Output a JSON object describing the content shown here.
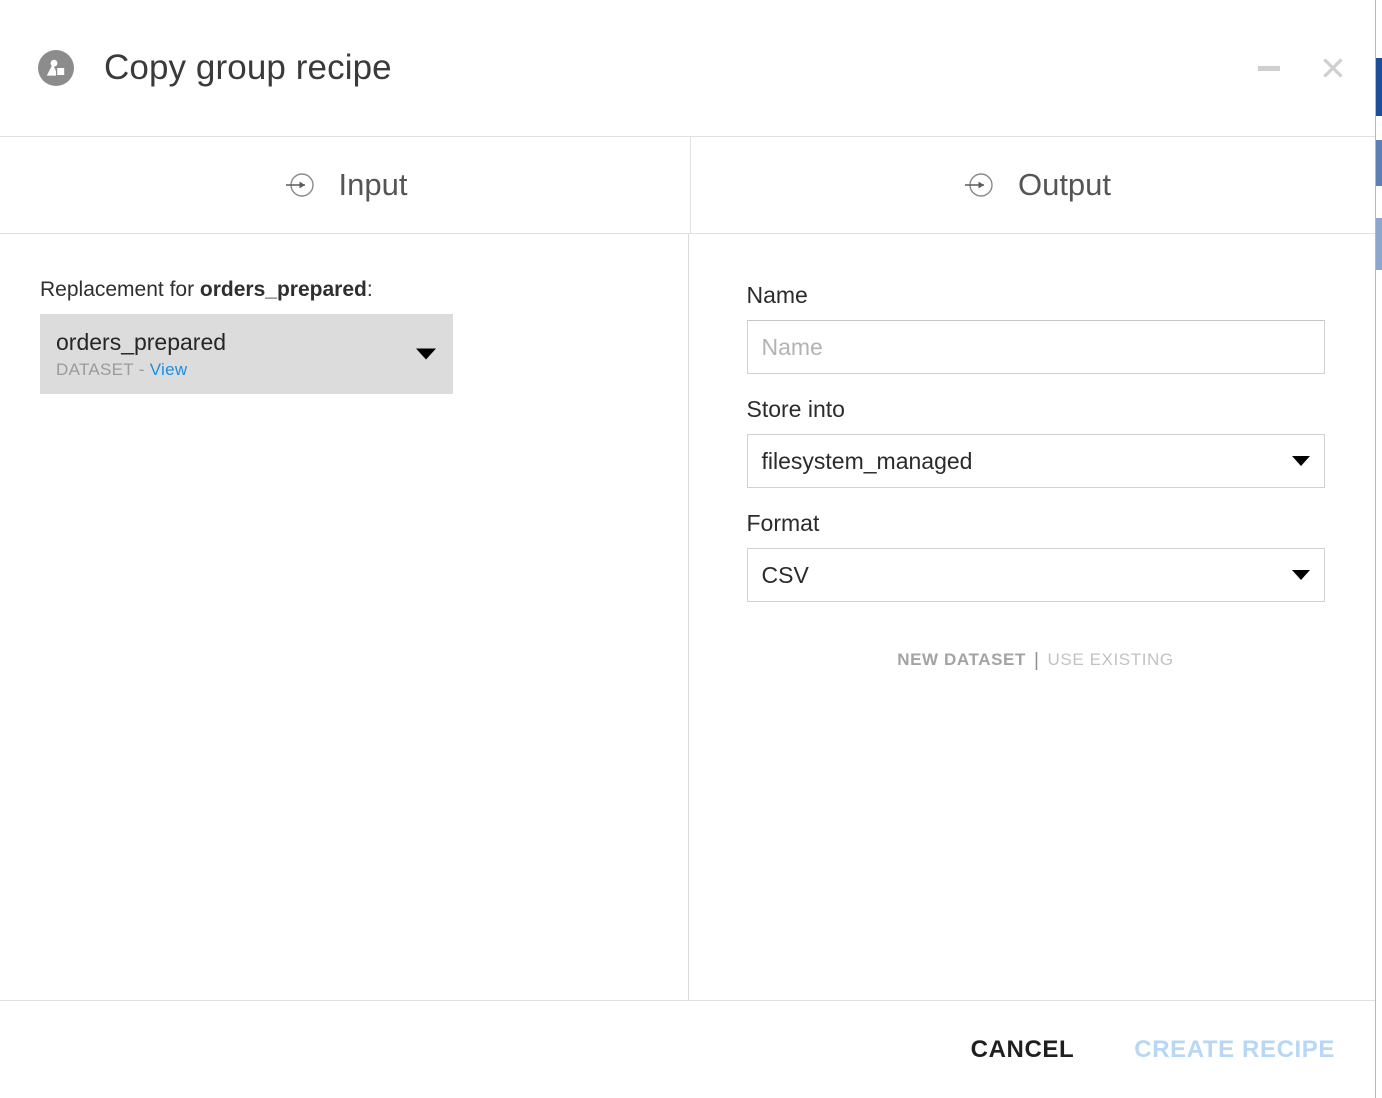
{
  "window": {
    "title": "Copy group recipe",
    "icon": "dataiku-recipe-icon",
    "controls": {
      "minimize_label": "–",
      "close_label": "✕"
    }
  },
  "tabs": [
    {
      "label": "Input",
      "icon": "arrow-into-circle-icon"
    },
    {
      "label": "Output",
      "icon": "arrow-into-circle-icon"
    }
  ],
  "input_pane": {
    "replacement_prefix": "Replacement for ",
    "replacement_target": "orders_prepared",
    "replacement_suffix": ":",
    "dataset": {
      "name": "orders_prepared",
      "type_label": "DATASET",
      "separator": " - ",
      "view_link": "View"
    }
  },
  "output_pane": {
    "name_field": {
      "label": "Name",
      "value": "",
      "placeholder": "Name"
    },
    "store_into_field": {
      "label": "Store into",
      "value": "filesystem_managed"
    },
    "format_field": {
      "label": "Format",
      "value": "CSV"
    },
    "mode": {
      "new_dataset": "NEW DATASET",
      "separator": "|",
      "use_existing": "USE EXISTING",
      "selected": "NEW DATASET"
    }
  },
  "footer": {
    "cancel_label": "CANCEL",
    "create_label": "CREATE RECIPE"
  },
  "colors": {
    "link_blue": "#1a8fe3",
    "create_disabled_blue": "#b7d7f5",
    "scrollbar_blue": "#1c4e9c",
    "dataset_box_gray": "#dcdcdc"
  }
}
